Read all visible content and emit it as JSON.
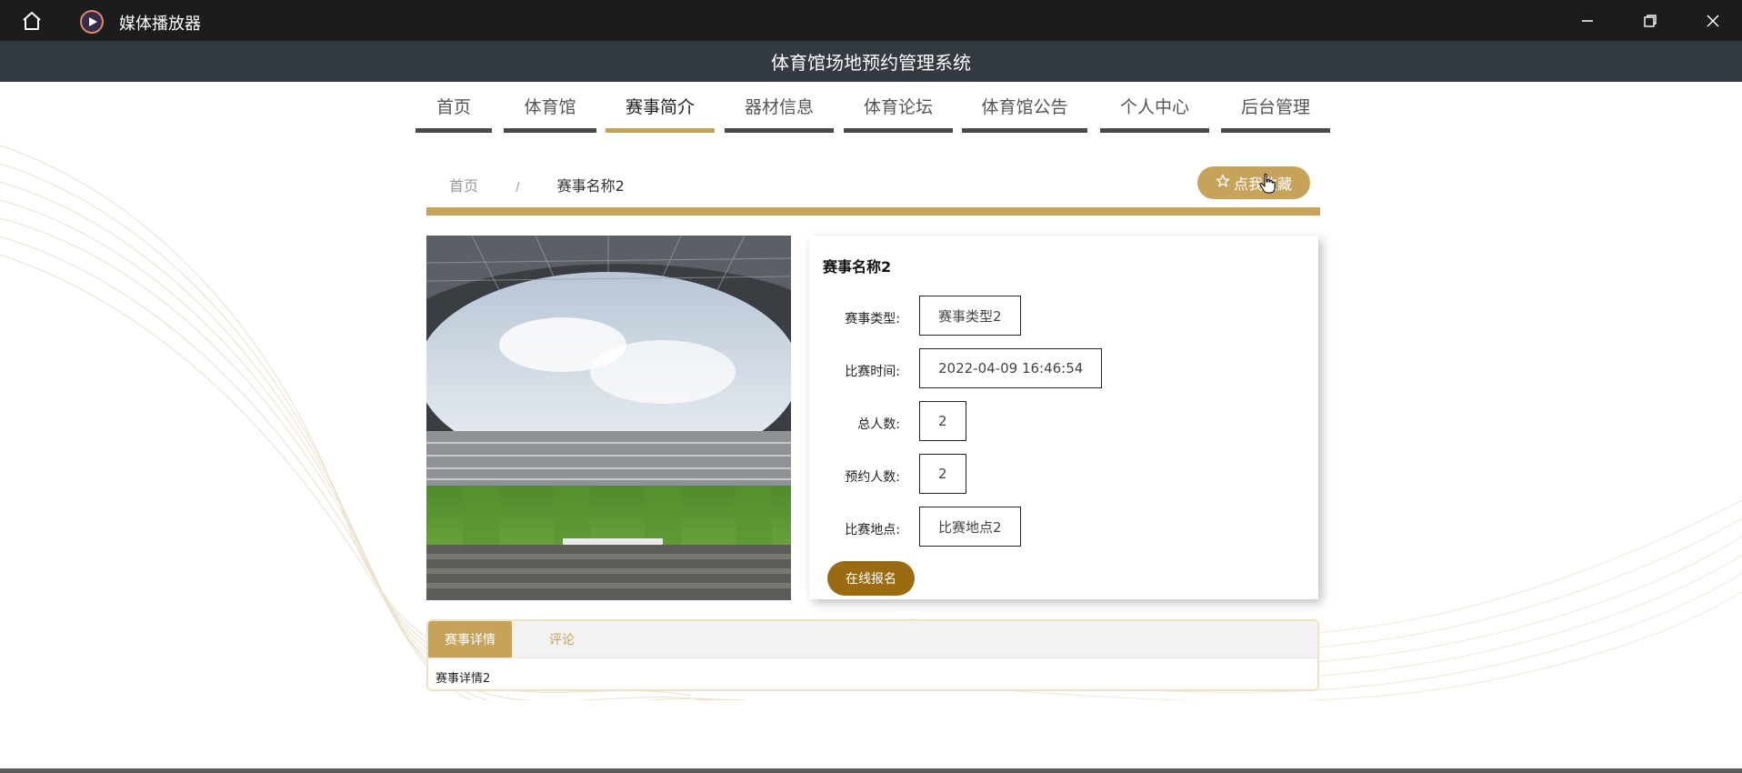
{
  "window": {
    "app_title": "媒体播放器",
    "icons": [
      "home-icon",
      "media-player-icon",
      "minimize-icon",
      "restore-icon",
      "close-icon"
    ]
  },
  "site": {
    "title": "体育馆场地预约管理系统"
  },
  "nav": {
    "items": [
      {
        "label": "首页"
      },
      {
        "label": "体育馆"
      },
      {
        "label": "赛事简介"
      },
      {
        "label": "器材信息"
      },
      {
        "label": "体育论坛"
      },
      {
        "label": "体育馆公告"
      },
      {
        "label": "个人中心"
      },
      {
        "label": "后台管理"
      }
    ],
    "active_index": 2
  },
  "breadcrumb": {
    "home": "首页",
    "separator": "/",
    "current": "赛事名称2"
  },
  "favorite_button": {
    "icon": "star-outline-icon",
    "label": "点我收藏"
  },
  "event": {
    "name": "赛事名称2",
    "fields": [
      {
        "label": "赛事类型:",
        "value": "赛事类型2"
      },
      {
        "label": "比赛时间:",
        "value": "2022-04-09 16:46:54"
      },
      {
        "label": "总人数:",
        "value": "2"
      },
      {
        "label": "预约人数:",
        "value": "2"
      },
      {
        "label": "比赛地点:",
        "value": "比赛地点2"
      }
    ],
    "enroll_label": "在线报名"
  },
  "tabs": {
    "items": [
      {
        "label": "赛事详情"
      },
      {
        "label": "评论"
      }
    ],
    "content": "赛事详情2"
  },
  "colors": {
    "accent_gold": "#c6a35a",
    "enroll_brown": "#9a6b10",
    "header_dark": "#343a41",
    "titlebar": "#1c1c1c"
  }
}
